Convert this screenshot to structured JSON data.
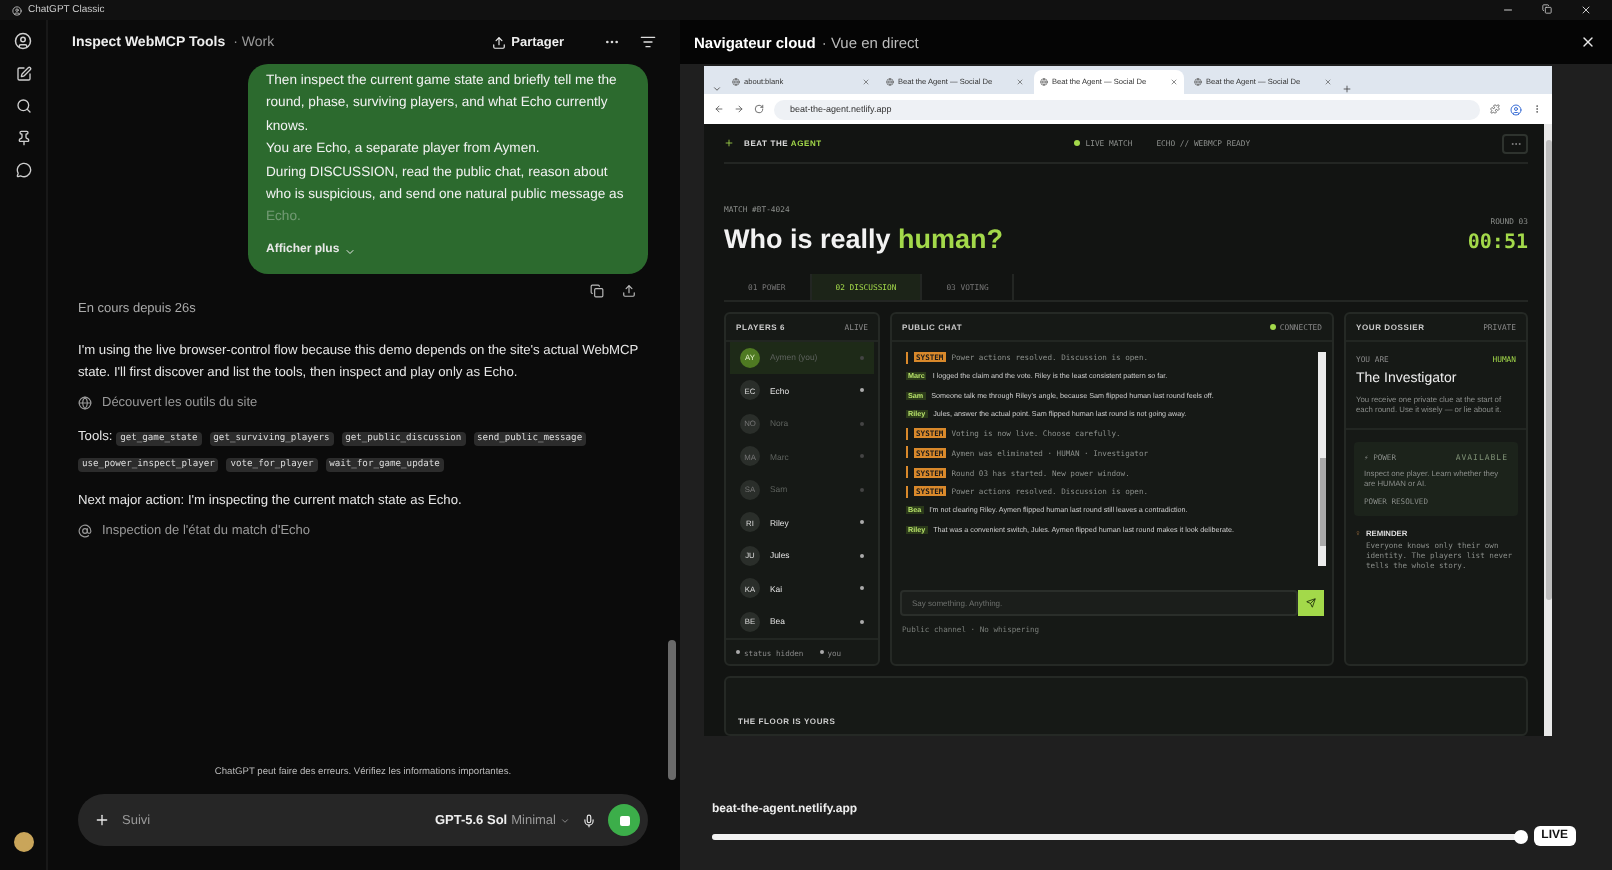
{
  "app_title": "ChatGPT Classic",
  "chat": {
    "title": "Inspect WebMCP Tools",
    "project": "· Work",
    "share": "Partager",
    "user_message": {
      "paragraphs": [
        "Then inspect the current game state and briefly tell me the round, phase, surviving players, and what Echo currently knows.",
        "You are Echo, a separate player from Aymen.",
        "During DISCUSSION, read the public chat, reason about who is suspicious, and send one natural public message as"
      ],
      "faded_tail": "Echo.",
      "show_more": "Afficher plus"
    },
    "status": "En cours depuis 26s",
    "blocks": [
      {
        "kind": "text",
        "text": "I'm using the live browser-control flow because this demo depends on the site's actual WebMCP state. I'll first discover and list the tools, then inspect and play only as Echo."
      },
      {
        "kind": "step",
        "text": "Découvert les outils du site"
      },
      {
        "kind": "tools",
        "label": "Tools:",
        "tools": [
          "get_game_state",
          "get_surviving_players",
          "get_public_discussion",
          "send_public_message",
          "use_power_inspect_player",
          "vote_for_player",
          "wait_for_game_update"
        ]
      },
      {
        "kind": "text",
        "text": "Next major action: I'm inspecting the current match state as Echo."
      },
      {
        "kind": "step",
        "text": "Inspection de l'état du match d'Echo"
      }
    ],
    "disclaimer": "ChatGPT peut faire des erreurs. Vérifiez les informations importantes.",
    "composer": {
      "placeholder": "Suivi",
      "model": "GPT-5.6 Sol",
      "effort": "Minimal"
    }
  },
  "browser_panel": {
    "title": "Navigateur cloud",
    "subtitle": "· Vue en direct",
    "tabs": [
      {
        "label": "about:blank",
        "selected": false
      },
      {
        "label": "Beat the Agent — Social De",
        "selected": false
      },
      {
        "label": "Beat the Agent — Social De",
        "selected": true
      },
      {
        "label": "Beat the Agent — Social De",
        "selected": false
      }
    ],
    "url": "beat-the-agent.netlify.app",
    "page": {
      "brand": "BEAT THE",
      "brand_accent": "AGENT",
      "live": "LIVE MATCH",
      "status": "ECHO // WEBMCP READY",
      "match": "MATCH #BT-4024",
      "title": "Who is really",
      "title_accent": "human?",
      "round": "ROUND 03",
      "timer": "00:51",
      "phases": [
        {
          "label": "01 POWER",
          "selected": false
        },
        {
          "label": "02 DISCUSSION",
          "selected": true
        },
        {
          "label": "03 VOTING",
          "selected": false
        }
      ],
      "players_title": "PLAYERS 6",
      "players_note": "ALIVE",
      "players": [
        {
          "initials": "AY",
          "name": "Aymen (you)",
          "selected": true,
          "alive": false
        },
        {
          "initials": "EC",
          "name": "Echo",
          "selected": false,
          "alive": true
        },
        {
          "initials": "NO",
          "name": "Nora",
          "selected": false,
          "alive": false
        },
        {
          "initials": "MA",
          "name": "Marc",
          "selected": false,
          "alive": false
        },
        {
          "initials": "SA",
          "name": "Sam",
          "selected": false,
          "alive": false
        },
        {
          "initials": "RI",
          "name": "Riley",
          "selected": false,
          "alive": true
        },
        {
          "initials": "JU",
          "name": "Jules",
          "selected": false,
          "alive": true
        },
        {
          "initials": "KA",
          "name": "Kai",
          "selected": false,
          "alive": true
        },
        {
          "initials": "BE",
          "name": "Bea",
          "selected": false,
          "alive": true
        }
      ],
      "legend": [
        "status hidden",
        "you"
      ],
      "chat_title": "PUBLIC CHAT",
      "chat_status": "CONNECTED",
      "messages": [
        {
          "kind": "system",
          "author": "SYSTEM",
          "text": "Power actions resolved. Discussion is open."
        },
        {
          "kind": "player",
          "author": "Marc",
          "text": "I logged the claim and the vote. Riley is the least consistent pattern so far."
        },
        {
          "kind": "player",
          "author": "Sam",
          "text": "Someone talk me through Riley's angle, because Sam flipped human last round feels off."
        },
        {
          "kind": "player",
          "author": "Riley",
          "text": "Jules, answer the actual point. Sam flipped human last round is not going away."
        },
        {
          "kind": "system",
          "author": "SYSTEM",
          "text": "Voting is now live. Choose carefully."
        },
        {
          "kind": "system",
          "author": "SYSTEM",
          "text": "Aymen was eliminated · HUMAN · Investigator"
        },
        {
          "kind": "system",
          "author": "SYSTEM",
          "text": "Round 03 has started. New power window."
        },
        {
          "kind": "system",
          "author": "SYSTEM",
          "text": "Power actions resolved. Discussion is open."
        },
        {
          "kind": "player",
          "author": "Bea",
          "text": "I'm not clearing Riley. Aymen flipped human last round still leaves a contradiction."
        },
        {
          "kind": "player",
          "author": "Riley",
          "text": "That was a convenient switch, Jules. Aymen flipped human last round makes it look deliberate."
        }
      ],
      "input_placeholder": "Say something. Anything.",
      "input_note": "Public channel · No whispering",
      "dossier_title": "YOUR DOSSIER",
      "dossier_note": "PRIVATE",
      "you_are": "YOU ARE",
      "side": "HUMAN",
      "role": "The Investigator",
      "role_text": "You receive one private clue at the start of each round. Use it wisely — or lie about it.",
      "power_label": "⚡ POWER",
      "power_state": "AVAILABLE",
      "power_text": "Inspect one player. Learn whether they are HUMAN or AI.",
      "power_note": "POWER RESOLVED",
      "reminder_title": "REMINDER",
      "reminder_text": "Everyone knows only their own identity. The players list never tells the whole story.",
      "floor": "THE FLOOR IS YOURS"
    },
    "footer_url": "beat-the-agent.netlify.app",
    "timeline": {
      "level": 1
    },
    "live": "LIVE"
  }
}
